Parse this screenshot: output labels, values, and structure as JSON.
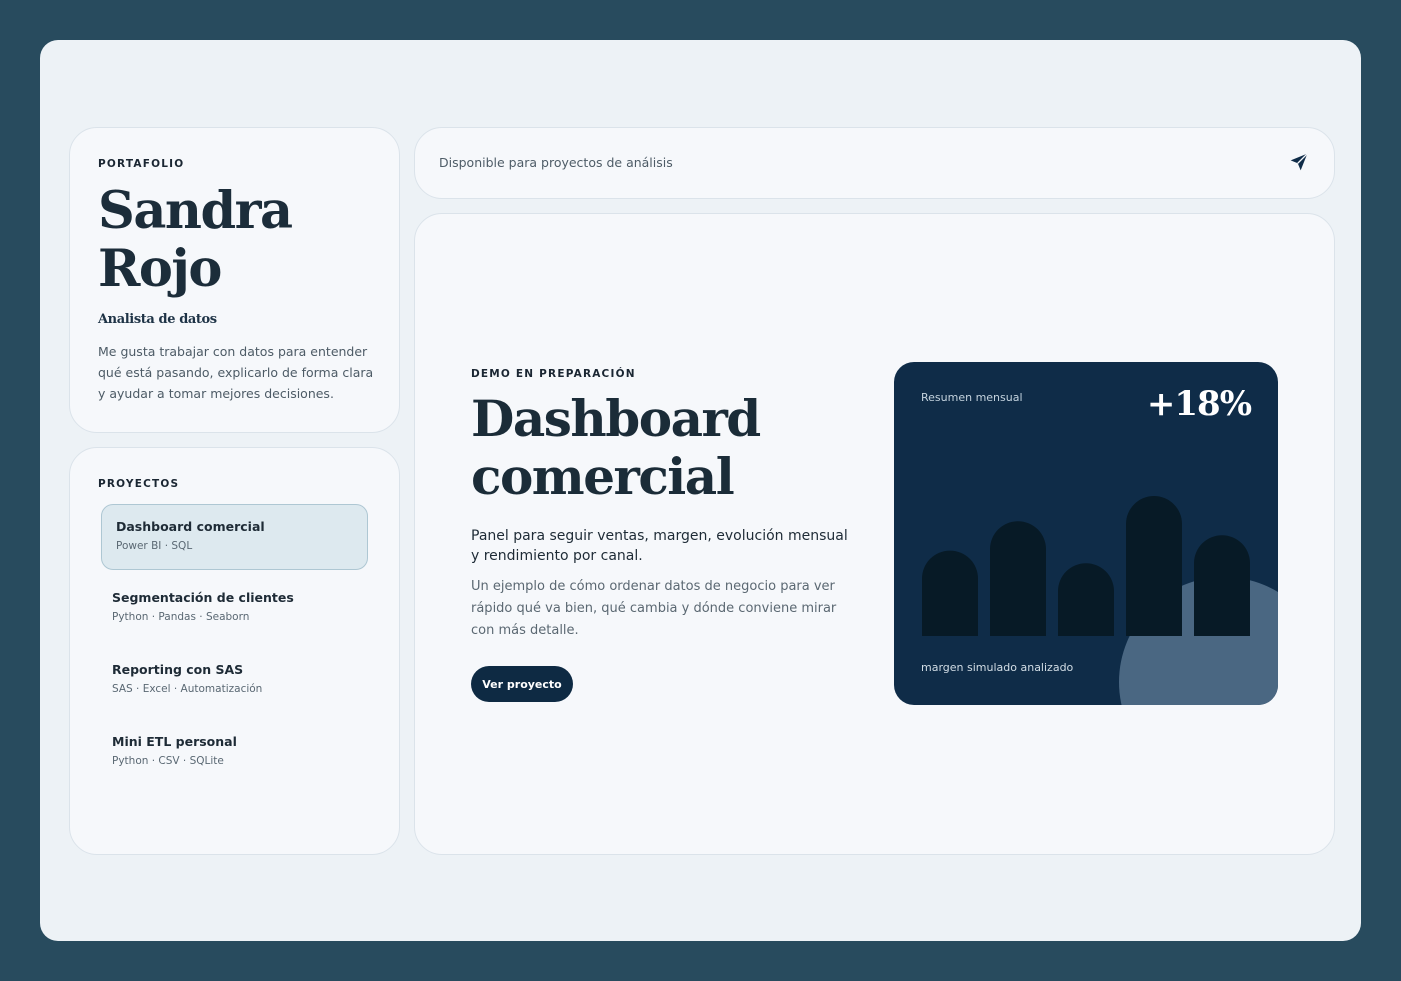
{
  "profile": {
    "eyebrow": "PORTAFOLIO",
    "name_first": "Sandra",
    "name_last": "Rojo",
    "role": "Analista de datos",
    "bio": "Me gusta trabajar con datos para entender qué está pasando, explicarlo de forma clara y ayudar a tomar mejores decisiones."
  },
  "projects": {
    "eyebrow": "PROYECTOS",
    "items": [
      {
        "title": "Dashboard comercial",
        "tags": "Power BI · SQL",
        "active": true
      },
      {
        "title": "Segmentación de clientes",
        "tags": "Python · Pandas · Seaborn",
        "active": false
      },
      {
        "title": "Reporting con SAS",
        "tags": "SAS · Excel · Automatización",
        "active": false
      },
      {
        "title": "Mini ETL personal",
        "tags": "Python · CSV · SQLite",
        "active": false
      }
    ]
  },
  "topbar": {
    "availability": "Disponible para proyectos de análisis",
    "send_icon": "send-icon"
  },
  "main": {
    "eyebrow": "DEMO EN PREPARACIÓN",
    "title_line1": "Dashboard",
    "title_line2": "comercial",
    "lead": "Panel para seguir ventas, margen, evolución mensual y rendimiento por canal.",
    "description": "Un ejemplo de cómo ordenar datos de negocio para ver rápido qué va bien, qué cambia y dónde conviene mirar con más detalle.",
    "cta_label": "Ver proyecto"
  },
  "summary_card": {
    "label": "Resumen mensual",
    "value": "+18%",
    "footer": "margen simulado analizado",
    "bar_values": [
      0.61,
      0.82,
      0.52,
      1.0,
      0.72
    ]
  },
  "colors": {
    "background": "#284b5e",
    "frame": "#edf2f6",
    "card": "#f6f8fb",
    "accent": "#0e2a43",
    "chart_card": "#0f2c48",
    "bars": "#071a26",
    "blob": "#4a6782",
    "active_item": "#dde9ef"
  }
}
